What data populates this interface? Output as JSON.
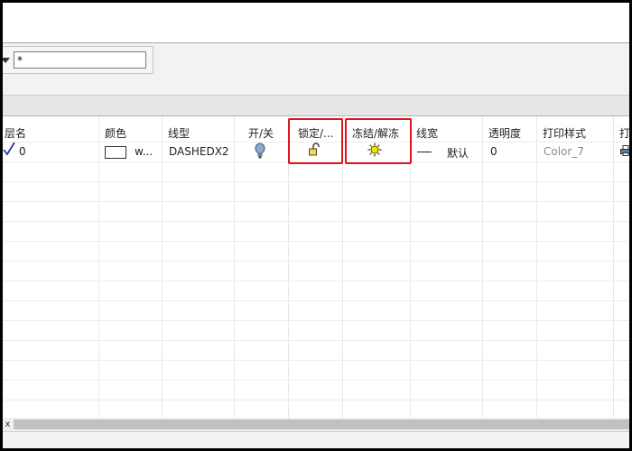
{
  "filter": {
    "value": "*",
    "arrow_icon": "dropdown-arrow-icon"
  },
  "columns": {
    "name": "层名",
    "color": "颜色",
    "linetype": "线型",
    "on_off": "开/关",
    "lock": "锁定/...",
    "freeze": "冻结/解冻",
    "lineweight": "线宽",
    "transparency": "透明度",
    "plot_style": "打印样式",
    "plot": "打"
  },
  "rows": [
    {
      "current_icon": "check-icon",
      "name": "0",
      "color_label": "w...",
      "color_swatch": "#ffffff",
      "linetype": "DASHEDX2",
      "on_icon": "lightbulb-on-icon",
      "lock_icon": "padlock-unlocked-icon",
      "freeze_icon": "sun-thawed-icon",
      "lineweight": "默认",
      "transparency": "0",
      "plot_style": "Color_7",
      "plot_icon": "printer-icon"
    }
  ],
  "highlight_color": "#e0141e",
  "scrollbar": {
    "left_glyph": "x"
  }
}
